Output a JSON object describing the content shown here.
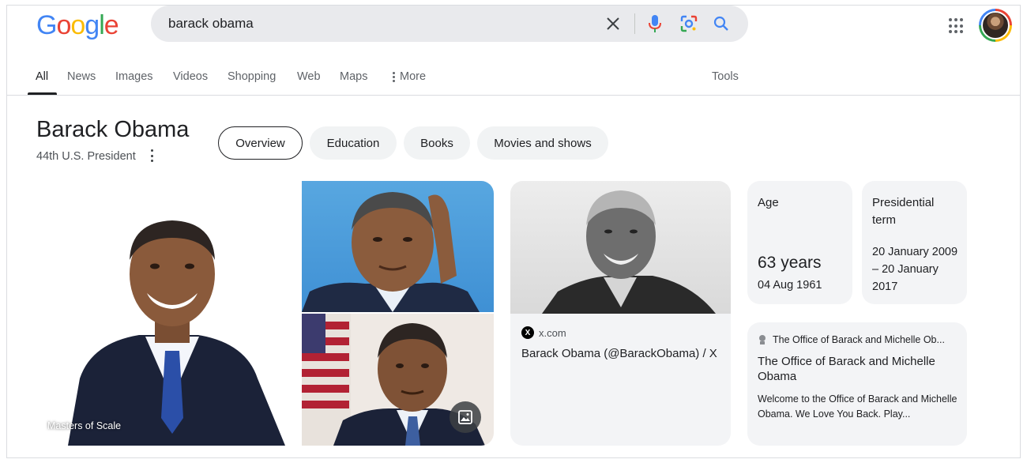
{
  "logo": {
    "letters": [
      "G",
      "o",
      "o",
      "g",
      "l",
      "e"
    ],
    "colors": [
      "#4285f4",
      "#ea4335",
      "#fbbc05",
      "#4285f4",
      "#34a853",
      "#ea4335"
    ]
  },
  "search": {
    "query": "barack obama",
    "icons": [
      "clear-icon",
      "microphone-icon",
      "lens-icon",
      "search-icon"
    ]
  },
  "tabs": {
    "items": [
      {
        "label": "All"
      },
      {
        "label": "News"
      },
      {
        "label": "Images"
      },
      {
        "label": "Videos"
      },
      {
        "label": "Shopping"
      },
      {
        "label": "Web"
      },
      {
        "label": "Maps"
      },
      {
        "label": "More"
      }
    ],
    "tools": "Tools"
  },
  "entity": {
    "title": "Barack Obama",
    "subtitle": "44th U.S. President",
    "chips": [
      {
        "label": "Overview"
      },
      {
        "label": "Education"
      },
      {
        "label": "Books"
      },
      {
        "label": "Movies and shows"
      }
    ]
  },
  "images": {
    "main_caption": "Masters of Scale"
  },
  "x_card": {
    "source": "x.com",
    "title": "Barack Obama (@BarackObama) / X"
  },
  "age": {
    "label": "Age",
    "value": "63 years",
    "date": "04 Aug 1961"
  },
  "term": {
    "label": "Presidential term",
    "value": "20 January 2009 – 20 January 2017"
  },
  "office": {
    "source": "The Office of Barack and Michelle Ob...",
    "title": "The Office of Barack and Michelle Obama",
    "description": "Welcome to the Office of Barack and Michelle Obama. We Love You Back. Play..."
  },
  "colors": {
    "accent_blue": "#1a73e8",
    "chip_bg": "#f1f3f4",
    "card_bg": "#f3f4f6"
  }
}
